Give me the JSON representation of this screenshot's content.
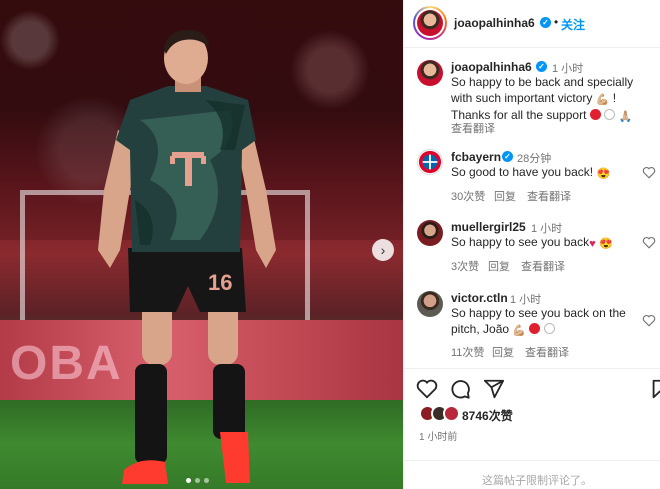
{
  "header": {
    "username": "joaopalhinha6",
    "follow_label": "关注",
    "separator": "•"
  },
  "caption": {
    "username": "joaopalhinha6",
    "time": "1 小时",
    "text_line1": "So happy to be back and specially",
    "text_line2": "with such important victory",
    "text_line3": "Thanks for all the support",
    "exclaim": "!",
    "translate": "查看翻译"
  },
  "comments": [
    {
      "username": "fcbayern",
      "time": "28分钟",
      "text": "So good to have you back!",
      "likes": "30次赞",
      "reply": "回复",
      "translate": "查看翻译"
    },
    {
      "username": "muellergirl25",
      "time": "1 小时",
      "text": "So happy to see you back",
      "likes": "3次赞",
      "reply": "回复",
      "translate": "查看翻译"
    },
    {
      "username": "victor.ctln",
      "time": "1 小时",
      "text_line1": "So happy to see you back on the",
      "text_line2": "pitch, João",
      "likes": "11次赞",
      "reply": "回复",
      "translate": "查看翻译"
    }
  ],
  "post": {
    "likes": "8746次赞",
    "time": "1 小时前",
    "comments_limited": "这篇帖子限制评论了。"
  },
  "photo": {
    "shirt_number": "16",
    "board_text": "OBA"
  },
  "icons": [
    "verified-icon",
    "heart-icon",
    "comment-icon",
    "share-icon",
    "bookmark-icon",
    "next-arrow-icon"
  ],
  "colors": {
    "accent": "#0095f6",
    "text": "#262626",
    "muted": "#737373",
    "bayern_red": "#dc052d"
  }
}
